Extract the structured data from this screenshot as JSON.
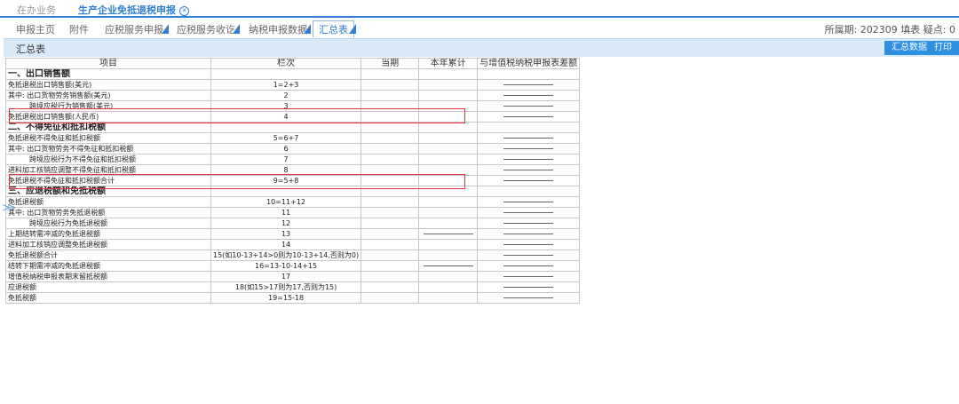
{
  "top_tabs": [
    {
      "label": "在办业务"
    },
    {
      "label": "生产企业免抵退税申报"
    }
  ],
  "sub_tabs": [
    {
      "label": "申报主页"
    },
    {
      "label": "附件"
    },
    {
      "label": "应税服务申报"
    },
    {
      "label": "应税服务收讫"
    },
    {
      "label": "纳税申报数据"
    },
    {
      "label": "汇总表"
    }
  ],
  "info": {
    "text": "所属期: 202309 填表 疑点: 0"
  },
  "panel": {
    "title": "汇总表",
    "buttons": [
      "汇总数据",
      "打印"
    ]
  },
  "table": {
    "headers": [
      "项目",
      "栏次",
      "当期",
      "本年累计",
      "与增值税纳税申报表差额"
    ],
    "rows": [
      {
        "item": "一、出口销售额",
        "col": "",
        "section": true
      },
      {
        "item": "免抵退税出口销售额(美元)",
        "col": "1=2+3",
        "d": [
          false,
          false,
          true
        ]
      },
      {
        "item": "其中: 出口货物劳务销售额(美元)",
        "col": "2",
        "d": [
          false,
          false,
          true
        ]
      },
      {
        "item": "跨境应税行为销售额(美元)",
        "col": "3",
        "indent": true,
        "d": [
          false,
          false,
          true
        ]
      },
      {
        "item": "免抵退税出口销售额(人民币)",
        "col": "4",
        "d": [
          false,
          false,
          true
        ]
      },
      {
        "item": "二、不得免征和抵扣税额",
        "col": "",
        "section": true
      },
      {
        "item": "免抵退税不得免征和抵扣税额",
        "col": "5=6+7",
        "d": [
          false,
          false,
          true
        ]
      },
      {
        "item": "其中: 出口货物劳务不得免征和抵扣税额",
        "col": "6",
        "d": [
          false,
          false,
          true
        ]
      },
      {
        "item": "跨境应税行为不得免征和抵扣税额",
        "col": "7",
        "indent": true,
        "d": [
          false,
          false,
          true
        ]
      },
      {
        "item": "进料加工核销应调整不得免征和抵扣税额",
        "col": "8",
        "d": [
          false,
          false,
          true
        ]
      },
      {
        "item": "免抵退税不得免征和抵扣税额合计",
        "col": "9=5+8",
        "d": [
          false,
          false,
          true
        ]
      },
      {
        "item": "三、应退税额和免抵税额",
        "col": "",
        "section": true
      },
      {
        "item": "免抵退税额",
        "col": "10=11+12",
        "d": [
          false,
          false,
          true
        ]
      },
      {
        "item": "其中: 出口货物劳务免抵退税额",
        "col": "11",
        "d": [
          false,
          false,
          true
        ]
      },
      {
        "item": "跨境应税行为免抵退税额",
        "col": "12",
        "indent": true,
        "d": [
          false,
          false,
          true
        ]
      },
      {
        "item": "上期结转需冲减的免抵退税额",
        "col": "13",
        "d": [
          false,
          true,
          true
        ]
      },
      {
        "item": "进料加工核销应调整免抵退税额",
        "col": "14",
        "d": [
          false,
          false,
          true
        ]
      },
      {
        "item": "免抵退税额合计",
        "col": "15(如10-13+14>0则为10-13+14,否则为0)",
        "d": [
          false,
          false,
          true
        ]
      },
      {
        "item": "结转下期需冲减的免抵退税额",
        "col": "16=13-10-14+15",
        "d": [
          false,
          true,
          true
        ]
      },
      {
        "item": "增值税纳税申报表期末留抵税额",
        "col": "17",
        "d": [
          false,
          false,
          true
        ]
      },
      {
        "item": "应退税额",
        "col": "18(如15>17则为17,否则为15)",
        "d": [
          false,
          false,
          true
        ]
      },
      {
        "item": "免抵税额",
        "col": "19=15-18",
        "d": [
          false,
          false,
          true
        ]
      }
    ]
  },
  "colors": {
    "accent": "#2f7fd6",
    "highlight": "#e0333a",
    "title_bar": "#d8e9f8"
  }
}
